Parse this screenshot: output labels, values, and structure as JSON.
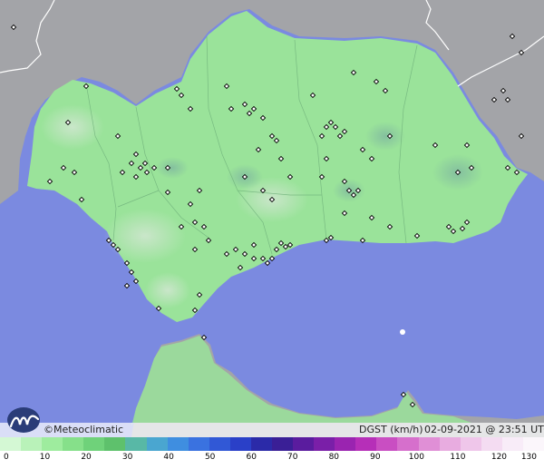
{
  "brand": {
    "text": "©Meteoclimatic"
  },
  "legend": {
    "title": "DGST (km/h)",
    "datetime": "02-09-2021 @ 23:51 UTC",
    "ticks": [
      "0",
      "10",
      "20",
      "30",
      "40",
      "50",
      "60",
      "70",
      "80",
      "90",
      "100",
      "110",
      "120",
      "130"
    ],
    "colors": [
      "#d4f8d4",
      "#b9f2b9",
      "#9eec9e",
      "#86e08a",
      "#6fd27a",
      "#5ec16c",
      "#58b8a6",
      "#4aa6d0",
      "#3f8ee0",
      "#3a72e0",
      "#3158d6",
      "#2a40c8",
      "#2b2aa8",
      "#3a1f96",
      "#5a1c9e",
      "#7a1fa8",
      "#9a24b0",
      "#b62fb8",
      "#c94ec2",
      "#d66fcc",
      "#e08fd6",
      "#e8ace0",
      "#efc6ea",
      "#f4dcf2",
      "#f8ecf8",
      "#fbf6fb"
    ]
  },
  "map": {
    "colors": {
      "sea": "#7b8ae0",
      "land": "#9ae39a",
      "outside_land": "#a3a4a8"
    }
  }
}
